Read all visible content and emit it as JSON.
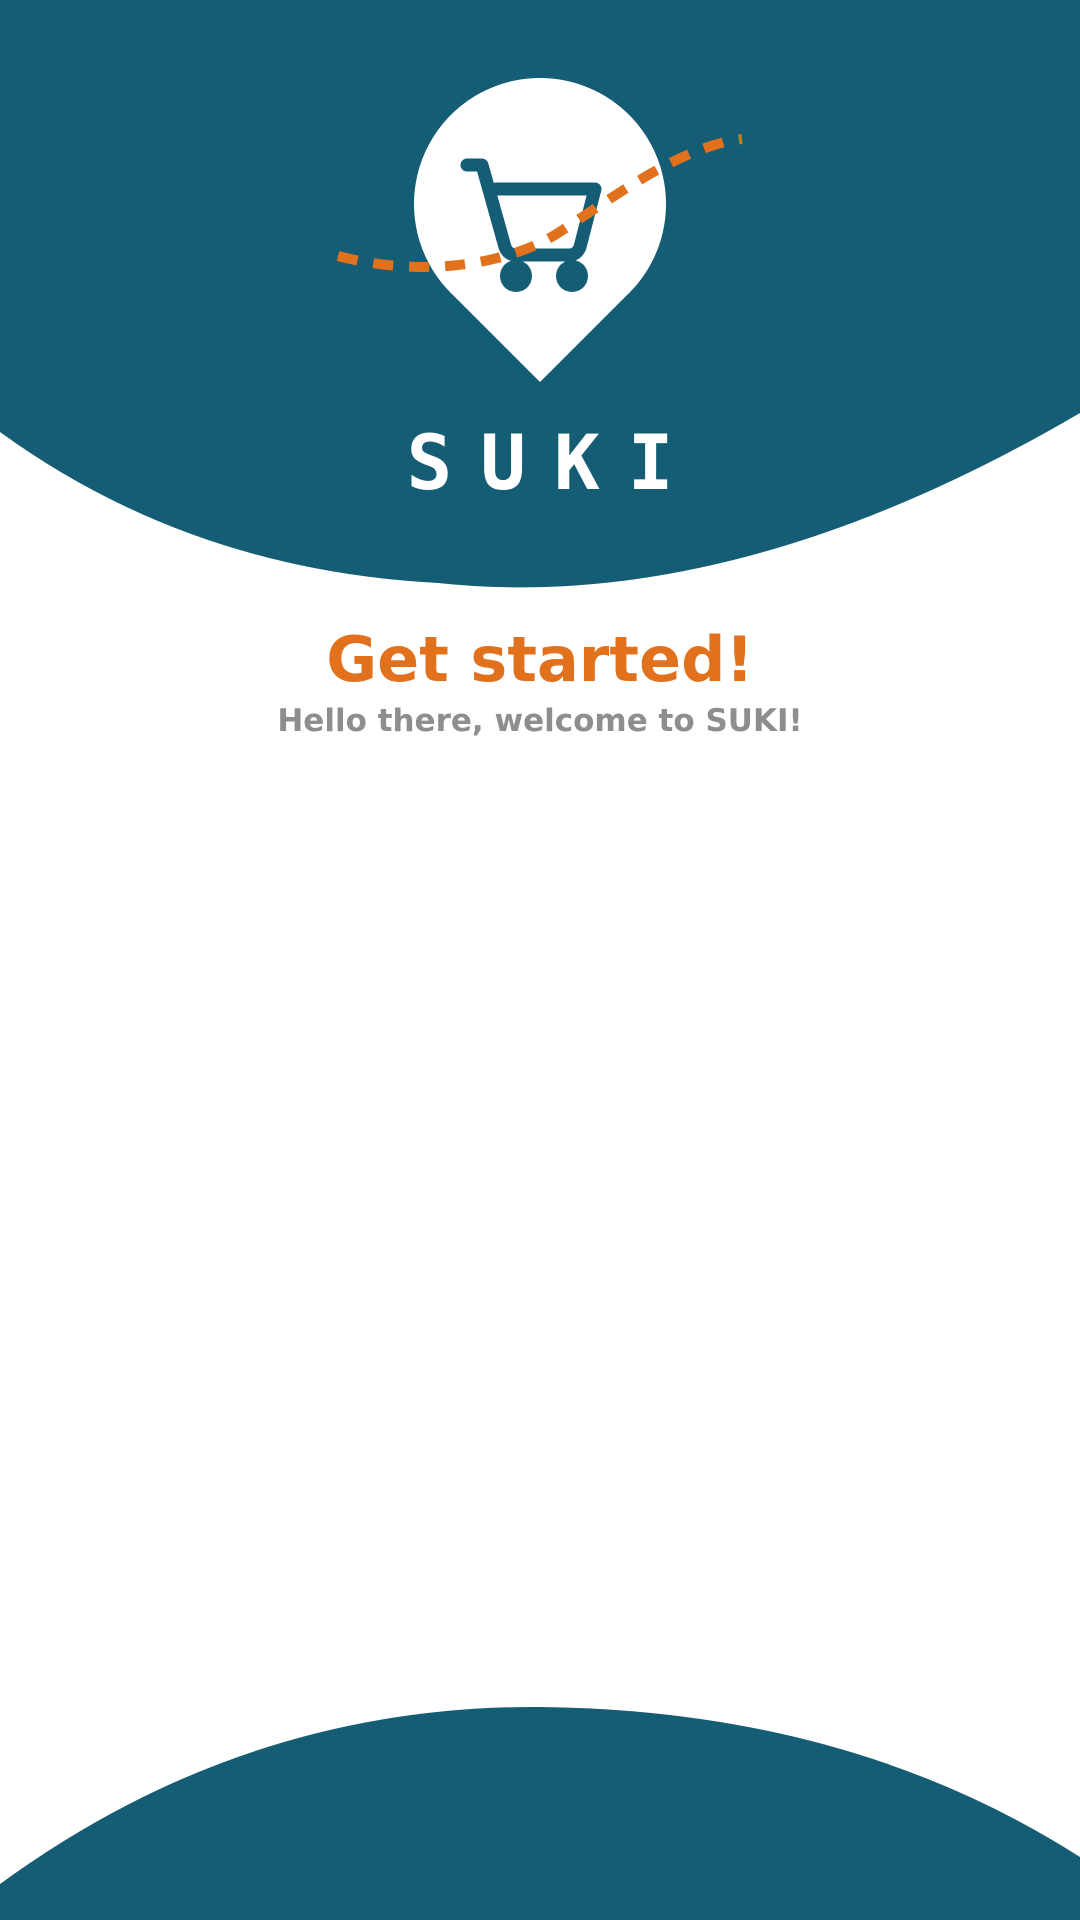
{
  "app": {
    "brand_name": "SUKI",
    "logo_icon": "shopping-cart-location-pin-icon"
  },
  "onboarding": {
    "title": "Get started!",
    "subtitle": "Hello there, welcome to SUKI!"
  },
  "colors": {
    "primary": "#155c75",
    "accent": "#e2711d",
    "background": "#ffffff",
    "subtitle_text": "#8e8e8e"
  }
}
